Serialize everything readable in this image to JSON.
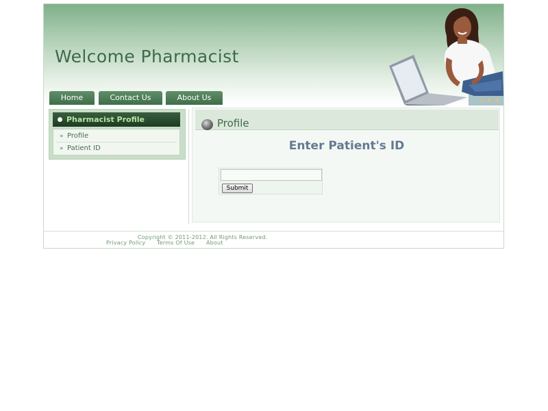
{
  "header": {
    "site_title": "Welcome Pharmacist"
  },
  "nav": {
    "tabs": [
      {
        "label": "Home"
      },
      {
        "label": "Contact Us"
      },
      {
        "label": "About Us"
      }
    ]
  },
  "sidebar": {
    "heading": "Pharmacist Profile",
    "items": [
      {
        "label": "Profile"
      },
      {
        "label": "Patient ID"
      }
    ],
    "bullet_glyph": "»"
  },
  "main": {
    "section_title": "Profile",
    "prompt": "Enter Patient's ID",
    "patient_id_value": "",
    "submit_label": "Submit"
  },
  "footer": {
    "copyright": "Copyright © 2011-2012. All Rights Reserved.",
    "links": [
      {
        "label": "Privacy Policy"
      },
      {
        "label": "Terms Of Use"
      },
      {
        "label": "About"
      }
    ]
  },
  "colors": {
    "brand_green": "#3f6e49",
    "title_green": "#3d6a4a",
    "prompt_blue_gray": "#647a93",
    "footer_green": "#6f9a6f"
  },
  "icons": {
    "hero_image": "woman-with-laptop-image",
    "section_icon": "gray-ball-icon"
  }
}
